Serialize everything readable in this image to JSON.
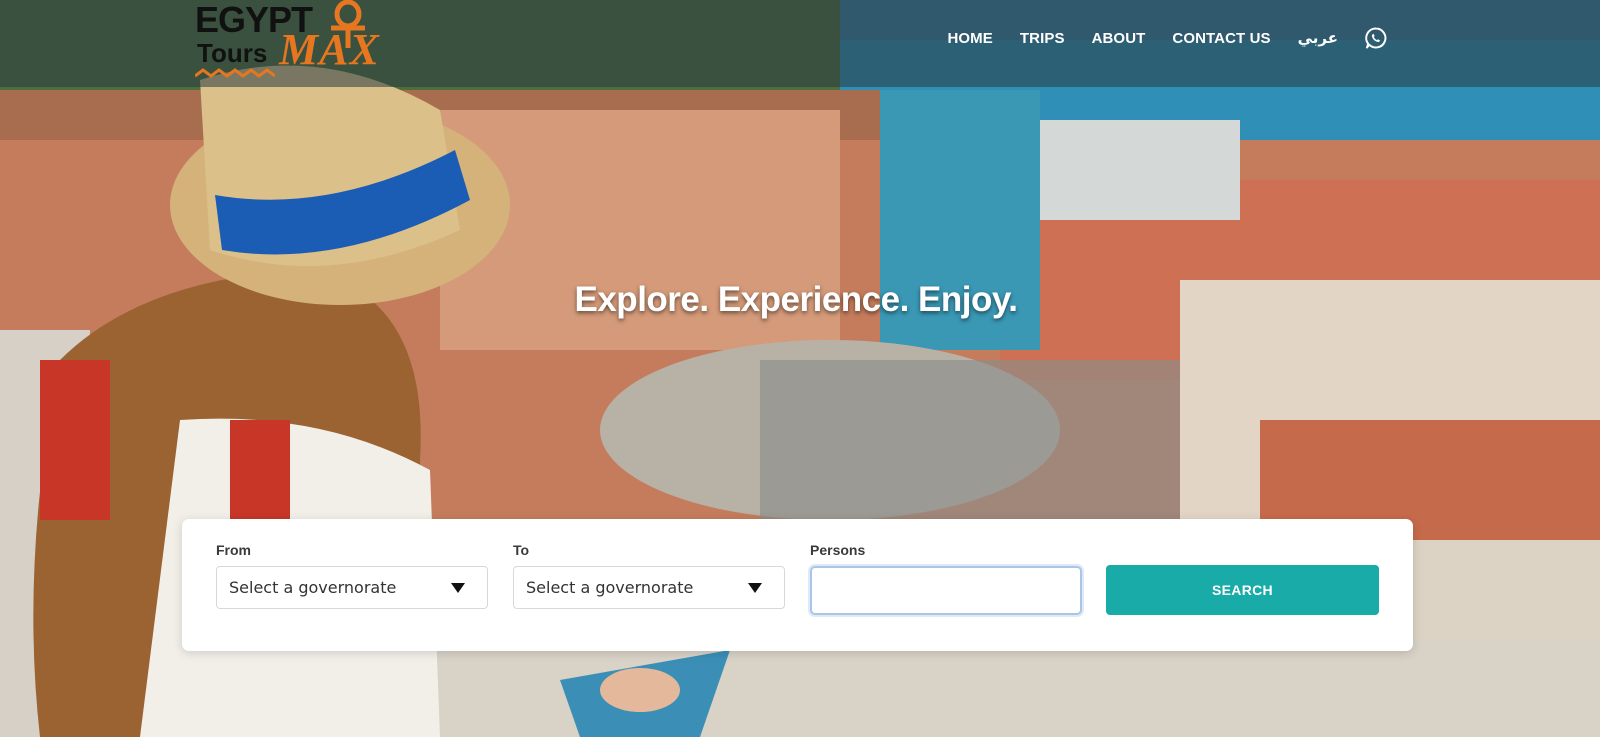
{
  "brand": {
    "logo_line1": "EGYPT",
    "logo_line2": "Tours",
    "logo_line3": "MAX",
    "accent_color": "#e6761f"
  },
  "nav": {
    "items": [
      {
        "label": "HOME"
      },
      {
        "label": "TRIPS"
      },
      {
        "label": "ABOUT"
      },
      {
        "label": "CONTACT US"
      }
    ],
    "language_label": "عربي",
    "whatsapp_icon": "whatsapp-icon"
  },
  "hero": {
    "headline": "Explore. Experience. Enjoy."
  },
  "search": {
    "from_label": "From",
    "from_value": "Select a governorate",
    "to_label": "To",
    "to_value": "Select a governorate",
    "persons_label": "Persons",
    "persons_value": "",
    "search_button": "SEARCH",
    "button_color": "#18aba8"
  }
}
